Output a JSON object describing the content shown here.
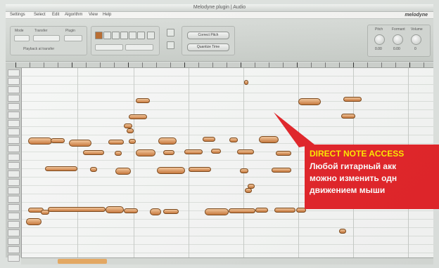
{
  "window": {
    "title": "Melodyne plugin | Audio"
  },
  "menubar": {
    "items": [
      "Settings",
      "Select",
      "Edit",
      "Algorithm",
      "View",
      "Help"
    ],
    "logo": "melodyne"
  },
  "toolbar": {
    "transport_labels": [
      "Mode",
      "Transfer",
      "Plugin"
    ],
    "transport_caption": "Playback at transfer",
    "buttons": [
      "Correct Pitch",
      "Quantize Time"
    ],
    "knob_labels": [
      "Pitch",
      "Formant",
      "Volume"
    ],
    "knob_values": [
      "0.00",
      "0.00",
      "0"
    ]
  },
  "callout": {
    "heading": "DIRECT NOTE ACCESS",
    "lines": [
      "Любой гитарный акк",
      "можно изменить одн",
      "движением мыши"
    ]
  },
  "colors": {
    "note_fill": "#d98c4a",
    "callout_bg": "#e3252a",
    "callout_heading": "#ffeb00"
  }
}
